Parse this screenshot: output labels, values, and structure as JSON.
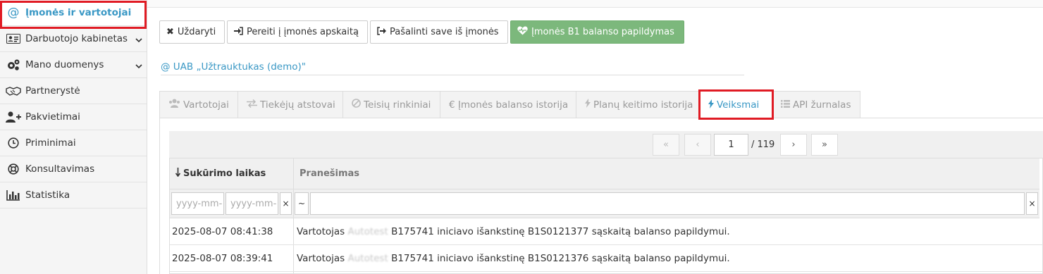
{
  "sidebar": {
    "items": [
      {
        "label": "Įmonės ir vartotojai",
        "icon": "at-icon"
      },
      {
        "label": "Darbuotojo kabinetas",
        "icon": "id-card-icon"
      },
      {
        "label": "Mano duomenys",
        "icon": "gears-icon"
      },
      {
        "label": "Partnerystė",
        "icon": "handshake-icon"
      },
      {
        "label": "Pakvietimai",
        "icon": "user-plus-icon"
      },
      {
        "label": "Priminimai",
        "icon": "clock-icon"
      },
      {
        "label": "Konsultavimas",
        "icon": "lifebuoy-icon"
      },
      {
        "label": "Statistika",
        "icon": "bar-chart-icon"
      }
    ]
  },
  "toolbar": {
    "close_label": "Uždaryti",
    "goto_label": "Pereiti į įmonės apskaitą",
    "remove_label": "Pašalinti save iš įmonės",
    "topup_label": "Įmonės B1 balanso papildymas"
  },
  "company": {
    "name": "@ UAB „Užtrauktukas (demo)\""
  },
  "tabs": [
    {
      "label": "Vartotojai",
      "icon": "users-icon"
    },
    {
      "label": "Tiekėjų atstovai",
      "icon": "exchange-icon"
    },
    {
      "label": "Teisių rinkiniai",
      "icon": "ban-icon"
    },
    {
      "label": "€ Įmonės balanso istorija",
      "icon": ""
    },
    {
      "label": "Planų keitimo istorija",
      "icon": "bolt-icon"
    },
    {
      "label": "Veiksmai",
      "icon": "bolt-icon"
    },
    {
      "label": "API žurnalas",
      "icon": "list-icon"
    }
  ],
  "pager": {
    "first": "«",
    "prev": "‹",
    "page": "1",
    "total": "/ 119",
    "next": "›",
    "last": "»"
  },
  "table": {
    "columns": [
      "Sukūrimo laikas",
      "Pranešimas"
    ],
    "filters": {
      "date_from_placeholder": "yyyy-mm-",
      "date_to_placeholder": "yyyy-mm-",
      "clear": "×",
      "tilde": "~"
    },
    "rows": [
      {
        "time": "2025-08-07 08:41:38",
        "msg_a": "Vartotojas",
        "msg_hidden": "Autotest",
        "msg_b": "B175741 iniciavo išankstinę B1S0121377 sąskaitą balanso papildymui."
      },
      {
        "time": "2025-08-07 08:39:41",
        "msg_a": "Vartotojas",
        "msg_hidden": "Autotest",
        "msg_b": "B175741 iniciavo išankstinę B1S0121376 sąskaitą balanso papildymui."
      }
    ]
  },
  "colors": {
    "accent": "#3a98c5",
    "green": "#7cb87c",
    "highlight": "#e01b24"
  }
}
